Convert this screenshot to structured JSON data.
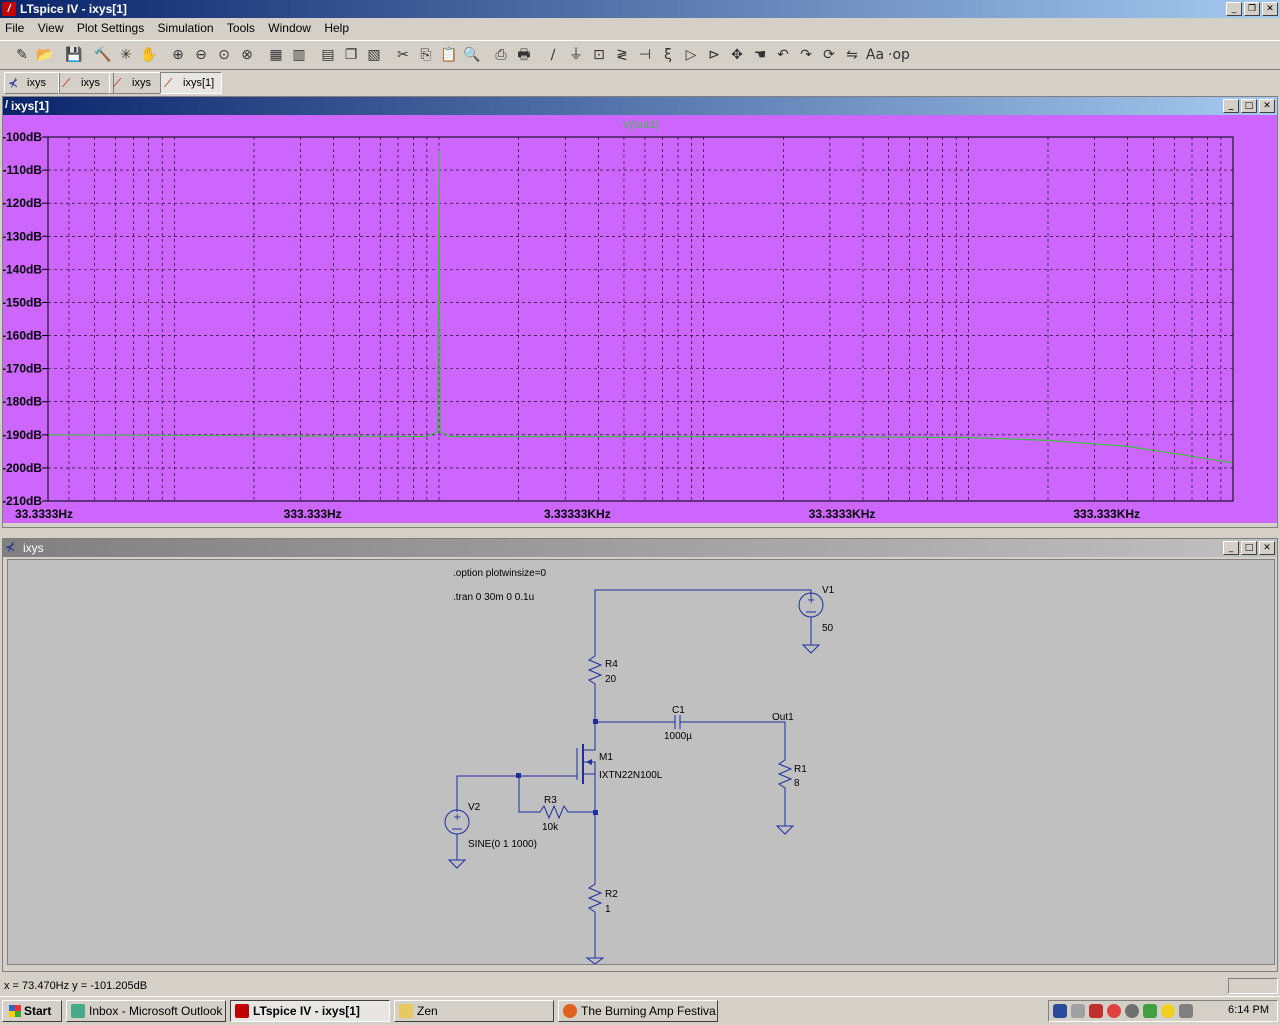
{
  "window": {
    "title": "LTspice IV - ixys[1]"
  },
  "menu": [
    "File",
    "View",
    "Plot Settings",
    "Simulation",
    "Tools",
    "Window",
    "Help"
  ],
  "toolbar_icons": [
    "new-schematic-icon",
    "open-icon",
    "save-icon",
    "control-panel-icon",
    "run-icon",
    "halt-icon",
    "zoom-in-icon",
    "zoom-out-icon",
    "zoom-fit-icon",
    "zoom-cancel-icon",
    "autorange-icon",
    "grid-icon",
    "tile-horizontal-icon",
    "cascade-icon",
    "tile-vertical-icon",
    "cut-icon",
    "copy-icon",
    "paste-icon",
    "find-icon",
    "print-setup-icon",
    "print-icon",
    "wire-icon",
    "ground-icon",
    "label-icon",
    "resistor-icon",
    "capacitor-icon",
    "inductor-icon",
    "diode-icon",
    "component-icon",
    "move-icon",
    "drag-icon",
    "undo-icon",
    "redo-icon",
    "rotate-icon",
    "mirror-icon",
    "text-icon",
    "spice-directive-icon"
  ],
  "tabs": [
    {
      "label": "ixys",
      "icon": "schematic-icon"
    },
    {
      "label": "ixys",
      "icon": "waveform-icon"
    },
    {
      "label": "ixys",
      "icon": "waveform-icon"
    },
    {
      "label": "ixys[1]",
      "icon": "waveform-icon"
    }
  ],
  "plot_pane": {
    "title": "ixys[1]",
    "trace_label": "V(out1)"
  },
  "chart_data": {
    "type": "line",
    "xscale": "log",
    "series": [
      {
        "name": "V(out1)",
        "color": "#44bb44",
        "x": [
          33.3333,
          200,
          900,
          990,
          1000,
          1010,
          1100,
          20000,
          100000,
          200000,
          400000,
          700000,
          1000000
        ],
        "y": [
          -190,
          -190.3,
          -190.5,
          -189,
          -104,
          -189,
          -190.5,
          -190.5,
          -190.8,
          -191.7,
          -193.5,
          -196.5,
          -198.5
        ]
      }
    ],
    "xtick_labels": [
      "33.3333Hz",
      "333.333Hz",
      "3.33333KHz",
      "33.3333KHz",
      "333.333KHz"
    ],
    "xticks": [
      33.3333,
      333.333,
      3333.33,
      33333.3,
      333333
    ],
    "ytick_labels": [
      "-100dB",
      "-110dB",
      "-120dB",
      "-130dB",
      "-140dB",
      "-150dB",
      "-160dB",
      "-170dB",
      "-180dB",
      "-190dB",
      "-200dB",
      "-210dB"
    ],
    "yticks": [
      -100,
      -110,
      -120,
      -130,
      -140,
      -150,
      -160,
      -170,
      -180,
      -190,
      -200,
      -210
    ],
    "xlim": [
      33.3333,
      1000000
    ],
    "ylim": [
      -210,
      -100
    ],
    "grid": true
  },
  "schematic_pane": {
    "title": "ixys",
    "directives": [
      ".option plotwinsize=0",
      ".tran 0 30m 0 0.1u"
    ],
    "components": {
      "v1": {
        "name": "V1",
        "value": "50"
      },
      "r4": {
        "name": "R4",
        "value": "20"
      },
      "c1": {
        "name": "C1",
        "value": "1000µ"
      },
      "out_label": "Out1",
      "m1": {
        "name": "M1",
        "value": "IXTN22N100L"
      },
      "r1": {
        "name": "R1",
        "value": "8"
      },
      "v2": {
        "name": "V2",
        "value": "SINE(0 1 1000)"
      },
      "r3": {
        "name": "R3",
        "value": "10k"
      },
      "r2": {
        "name": "R2",
        "value": "1"
      }
    }
  },
  "status": {
    "text": "x = 73.470Hz     y = -101.205dB"
  },
  "taskbar": {
    "start": "Start",
    "tasks": [
      {
        "label": "Inbox - Microsoft Outlook",
        "active": false
      },
      {
        "label": "LTspice IV - ixys[1]",
        "active": true
      },
      {
        "label": "Zen",
        "active": false
      },
      {
        "label": "The Burning Amp Festiva...",
        "active": false
      }
    ],
    "clock": "6:14 PM",
    "tray_icons": [
      "language-en-icon",
      "network-icon",
      "security-icon",
      "antivirus-icon",
      "sync-icon",
      "chat-icon",
      "msn-icon",
      "volume-icon"
    ]
  }
}
